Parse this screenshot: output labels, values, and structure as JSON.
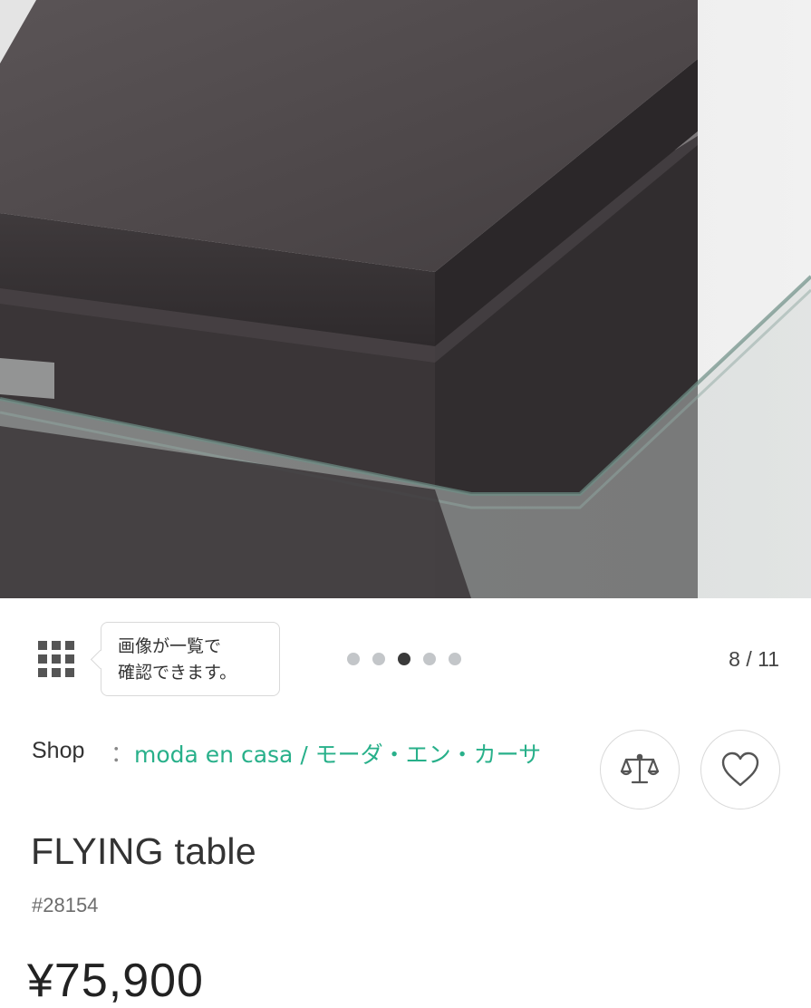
{
  "gallery": {
    "tooltip_line1": "画像が一覧で",
    "tooltip_line2": "確認できます。",
    "counter": "8 / 11",
    "current_index": 8,
    "total": 11,
    "dots_count": 5,
    "active_dot": 3
  },
  "shop": {
    "label": "Shop",
    "separator": "：",
    "name": "moda en casa / モーダ・エン・カーサ"
  },
  "product": {
    "title": "FLYING table",
    "id": "#28154",
    "price": "¥75,900"
  },
  "icons": {
    "grid": "grid-icon",
    "compare": "scale-icon",
    "favorite": "heart-icon"
  },
  "colors": {
    "accent": "#28b08a",
    "dot_active": "#3a3a3a",
    "dot_inactive": "#c3c6c9"
  }
}
